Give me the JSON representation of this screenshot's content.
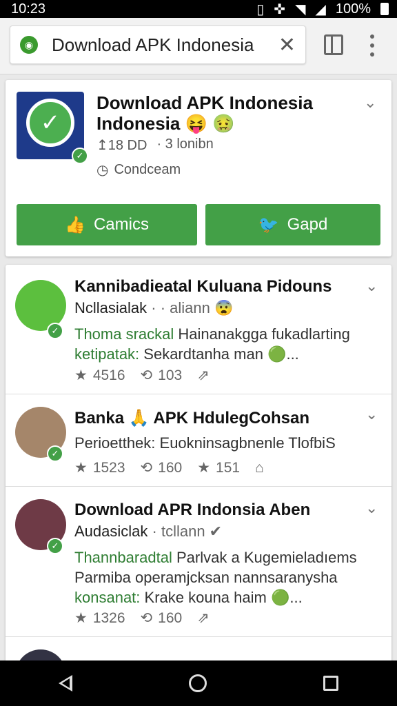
{
  "status": {
    "time": "10:23",
    "battery": "100%"
  },
  "browser": {
    "url": "Download APK Indonesia",
    "close_glyph": "✕"
  },
  "app": {
    "title": "Download APK Indonesia Indonesia 😝 🤢",
    "downloads": "↥18 DD",
    "size": "· 3 lonibn",
    "dev": "Condceam",
    "btn_left": "Camics",
    "btn_right": "Gapd"
  },
  "posts": [
    {
      "title": "Kannibadieatal Kuluana Pidouns",
      "sub_name": "Ncllasialak",
      "sub_meta": "· · aliann 😨",
      "body_green": "Thoma srackal",
      "body_rest": " Hainanakgga fukadlarting",
      "body2_green": "ketipatak:",
      "body2_rest": " Sekardtanha man 🟢...",
      "stats": [
        "4516",
        "103",
        ""
      ]
    },
    {
      "title": "Banka 🙏 APK HdulegCohsan",
      "body_rest": "Perioetthek: Euokninsagbnenle TlofbiS",
      "stats": [
        "1523",
        "160",
        "151"
      ]
    },
    {
      "title": "Download APR Indonsia Aben",
      "sub_name": "Audasiclak",
      "sub_meta": "· tcllann ✔",
      "body_green": "Thannbaradtal",
      "body_rest": " Parlvak a Kugemieladıems Parmiba operamjcksan nannsaranysha",
      "body2_green": "konsanat:",
      "body2_rest": " Krake kouna haim 🟢...",
      "stats": [
        "1326",
        "160",
        ""
      ]
    }
  ],
  "colors": {
    "accent": "#43a047",
    "text_green": "#2e7d32"
  }
}
